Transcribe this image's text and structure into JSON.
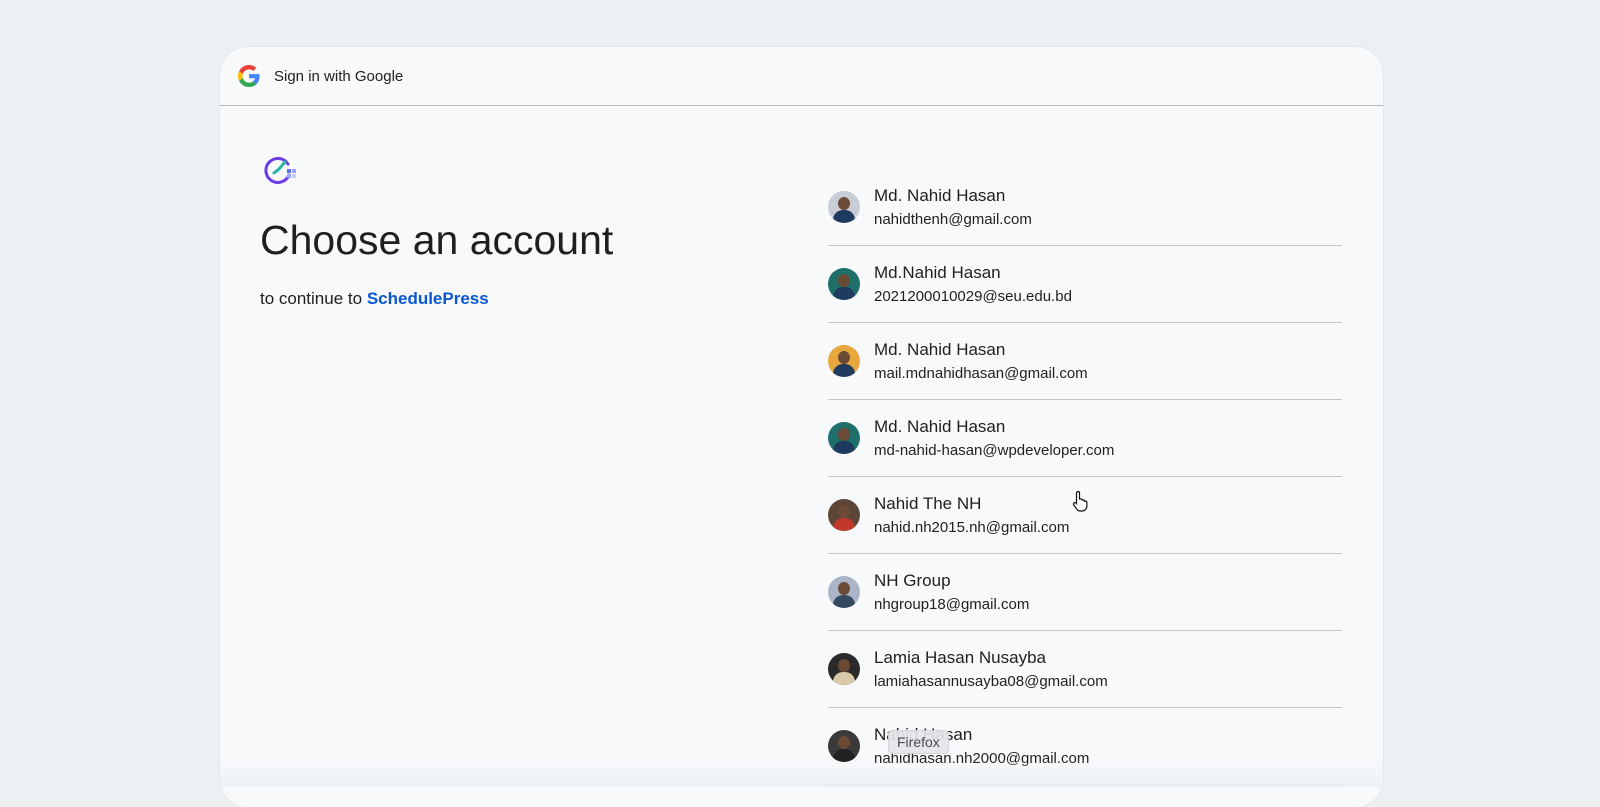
{
  "header": {
    "title": "Sign in with Google",
    "logo_icon": "google-g-icon"
  },
  "main": {
    "app_logo_icon": "schedulepress-logo-icon",
    "heading": "Choose an account",
    "subtitle_prefix": "to continue to ",
    "app_name": "SchedulePress"
  },
  "accounts": [
    {
      "name": "Md. Nahid Hasan",
      "email": "nahidthenh@gmail.com",
      "avatar_bg": "#c9ced6",
      "shirt": "#1e3a5f"
    },
    {
      "name": "Md.Nahid Hasan",
      "email": "2021200010029@seu.edu.bd",
      "avatar_bg": "#1f6f6a",
      "shirt": "#1e3a5f"
    },
    {
      "name": "Md. Nahid Hasan",
      "email": "mail.mdnahidhasan@gmail.com",
      "avatar_bg": "#e8a73c",
      "shirt": "#1e3a5f"
    },
    {
      "name": "Md. Nahid Hasan",
      "email": "md-nahid-hasan@wpdeveloper.com",
      "avatar_bg": "#1f6f6a",
      "shirt": "#1e3a5f"
    },
    {
      "name": "Nahid The NH",
      "email": "nahid.nh2015.nh@gmail.com",
      "avatar_bg": "#5b4636",
      "shirt": "#c0392b"
    },
    {
      "name": "NH Group",
      "email": "nhgroup18@gmail.com",
      "avatar_bg": "#aab5c8",
      "shirt": "#34495e"
    },
    {
      "name": "Lamia Hasan Nusayba",
      "email": "lamiahasannusayba08@gmail.com",
      "avatar_bg": "#2b2b2b",
      "shirt": "#d9c9a8"
    },
    {
      "name": "Nahid Hasan",
      "email": "nahidhasan.nh2000@gmail.com",
      "avatar_bg": "#3a3a3a",
      "shirt": "#222222"
    }
  ],
  "tooltip": "Firefox",
  "colors": {
    "link": "#0b57d0",
    "background": "#edf0f3",
    "card": "#f7f9fb"
  }
}
